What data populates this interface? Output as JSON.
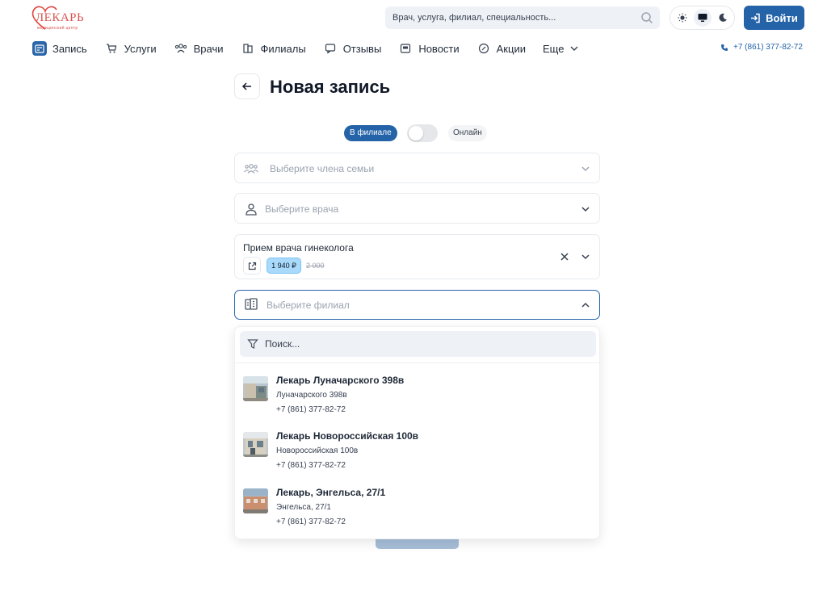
{
  "header": {
    "logo_text": "ЛЕКАРЬ",
    "logo_subtext": "медицинский центр",
    "search_placeholder": "Врач, услуга, филиал, специальность...",
    "login_label": "Войти",
    "phone": "+7 (861) 377-82-72"
  },
  "nav": {
    "items": [
      {
        "label": "Запись",
        "icon": "calendar-edit-icon"
      },
      {
        "label": "Услуги",
        "icon": "cart-icon"
      },
      {
        "label": "Врачи",
        "icon": "doctors-icon"
      },
      {
        "label": "Филиалы",
        "icon": "building-icon"
      },
      {
        "label": "Отзывы",
        "icon": "comment-icon"
      },
      {
        "label": "Новости",
        "icon": "news-icon"
      },
      {
        "label": "Акции",
        "icon": "promo-icon"
      }
    ],
    "more_label": "Еще"
  },
  "page": {
    "title": "Новая запись",
    "mode_branch": "В филиале",
    "mode_online": "Онлайн"
  },
  "form": {
    "family_placeholder": "Выберите члена семьи",
    "doctor_placeholder": "Выберите врача",
    "service_title": "Прием врача гинеколога",
    "service_price": "1 940 ₽",
    "service_old_price": "2 000",
    "branch_placeholder": "Выберите филиал"
  },
  "branch_dropdown": {
    "search_placeholder": "Поиск...",
    "options": [
      {
        "name": "Лекарь Луначарского 398в",
        "address": "Луначарского 398в",
        "phone": "+7 (861) 377-82-72"
      },
      {
        "name": "Лекарь Новороссийская 100в",
        "address": "Новороссийская 100в",
        "phone": "+7 (861) 377-82-72"
      },
      {
        "name": "Лекарь, Энгельса, 27/1",
        "address": "Энгельса, 27/1",
        "phone": "+7 (861) 377-82-72"
      }
    ]
  },
  "colors": {
    "primary": "#2563a8",
    "price_badge": "#a9dafb",
    "logo_red": "#d9534f"
  }
}
